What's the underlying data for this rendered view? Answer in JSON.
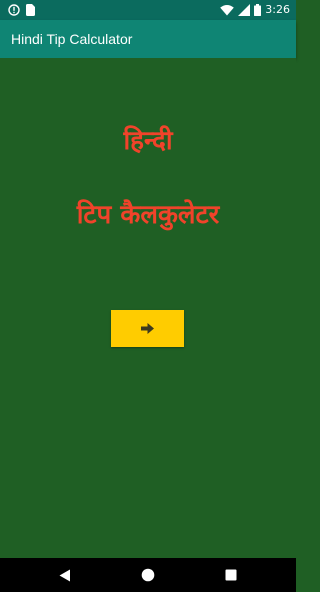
{
  "status_bar": {
    "time": "3:26",
    "icons": [
      "alert-icon",
      "sim-card-icon",
      "wifi-icon",
      "cellular-signal-icon",
      "battery-icon"
    ],
    "color": "#0b6b5e"
  },
  "app_bar": {
    "title": "Hindi Tip Calculator",
    "color": "#0f8574"
  },
  "main": {
    "headline_line1": "हिन्दी",
    "headline_line2": "टिप कैलकुलेटर",
    "text_color": "#f0432a",
    "background_color": "#1f5f24",
    "next_button": {
      "icon": "arrow-right-icon",
      "color": "#ffcc00"
    }
  },
  "nav_bar": {
    "buttons": [
      "back-icon",
      "home-icon",
      "recents-icon"
    ]
  }
}
